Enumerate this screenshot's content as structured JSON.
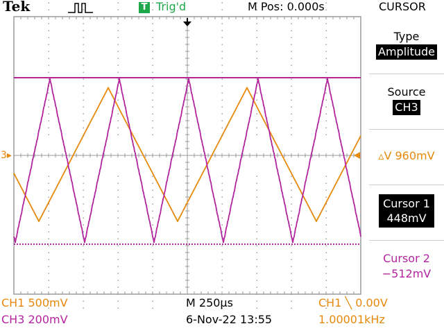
{
  "header": {
    "brand": "Tek",
    "trigger_icon": "T",
    "trigger_status": "Trig'd",
    "m_pos": "M Pos: 0.000s",
    "menu_title": "CURSOR"
  },
  "side_menu": {
    "type_label": "Type",
    "type_value": "Amplitude",
    "source_label": "Source",
    "source_value": "CH3",
    "delta": "▵V 960mV",
    "cursor1_label": "Cursor 1",
    "cursor1_value": "448mV",
    "cursor2_label": "Cursor 2",
    "cursor2_value": "−512mV"
  },
  "footer": {
    "ch1_scale": "CH1  500mV",
    "ch3_scale": "CH3  200mV",
    "timebase": "M 250µs",
    "datetime": "6-Nov-22 13:55",
    "trigger_setting": "CH1 ╲ 0.00V",
    "frequency": "1.00001kHz"
  },
  "markers": {
    "ch3_ref": "3▸"
  },
  "colors": {
    "ch1": "#e6890b",
    "ch3": "#b3249f",
    "trigger": "#1fa84a",
    "graticule": "#9a9a9a"
  },
  "icons": {
    "acquisition": "pulse-waveform-icon",
    "trigger_position": "down-arrow-icon",
    "ch1_level": "left-triangle-icon"
  },
  "waveforms": {
    "ch1": {
      "shape": "triangle",
      "period_div": 4,
      "min_div": -1.9,
      "max_div": 1.95
    },
    "ch3": {
      "shape": "triangle",
      "period_div": 2,
      "min_div": -2.5,
      "max_div": 2.2
    }
  },
  "cursors": {
    "cursor1_div": 2.24,
    "cursor2_div": -2.56
  }
}
